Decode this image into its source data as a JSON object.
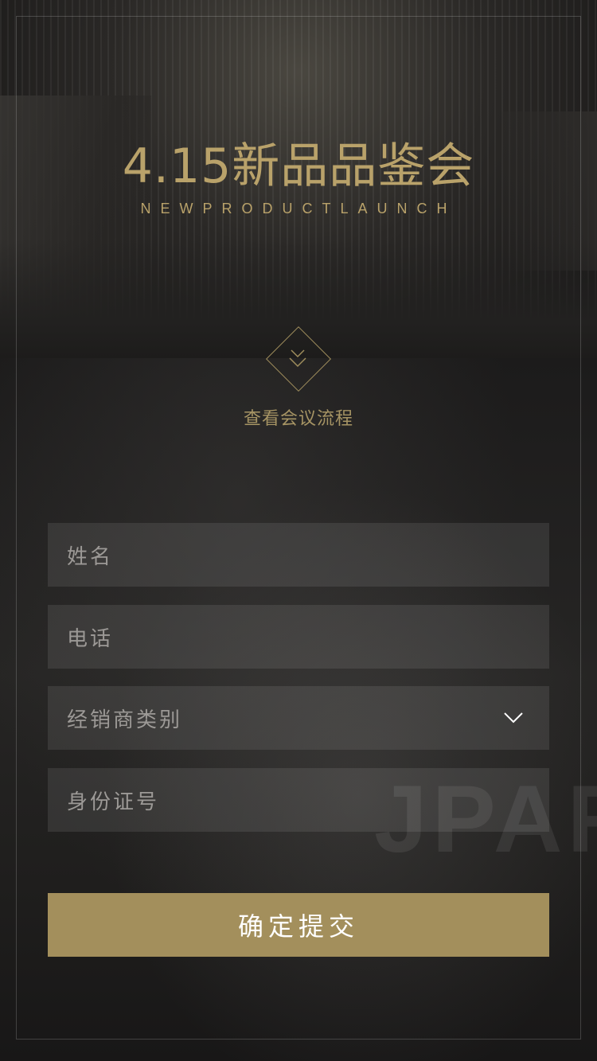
{
  "header": {
    "title": "4.15新品品鉴会",
    "subtitle": "NEWPRODUCTLAUNCH"
  },
  "agenda_link": {
    "label": "查看会议流程",
    "icon": "double-chevron-down-icon"
  },
  "form": {
    "name_placeholder": "姓名",
    "phone_placeholder": "电话",
    "dealer_type_placeholder": "经销商类别",
    "dealer_type_icon": "chevron-down-icon",
    "id_number_placeholder": "身份证号",
    "submit_label": "确定提交"
  },
  "background": {
    "watermark_text": "JPAR"
  },
  "colors": {
    "accent_gold": "#b9a26a",
    "button_gold": "#a38f5c",
    "field_bg": "rgba(255,255,255,0.09)",
    "page_bg": "#1b1a1a"
  }
}
